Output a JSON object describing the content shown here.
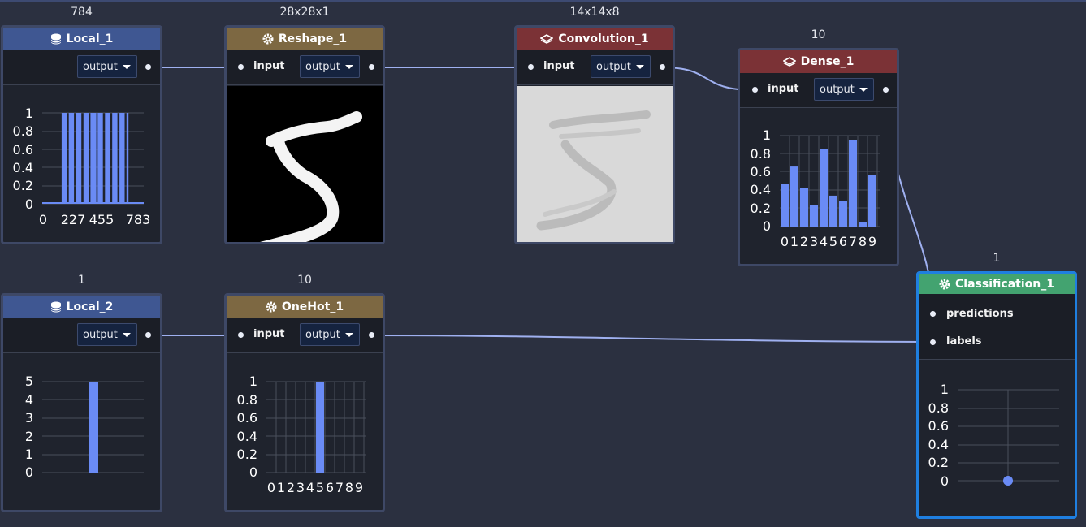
{
  "nodes": {
    "local1": {
      "title": "Local_1",
      "shape": "784",
      "icon": "database-icon",
      "output_label": "output"
    },
    "reshape1": {
      "title": "Reshape_1",
      "shape": "28x28x1",
      "icon": "gear-icon",
      "input_label": "input",
      "output_label": "output"
    },
    "conv1": {
      "title": "Convolution_1",
      "shape": "14x14x8",
      "icon": "layer-icon",
      "input_label": "input",
      "output_label": "output"
    },
    "dense1": {
      "title": "Dense_1",
      "shape": "10",
      "icon": "layer-icon",
      "input_label": "input",
      "output_label": "output"
    },
    "local2": {
      "title": "Local_2",
      "shape": "1",
      "icon": "database-icon",
      "output_label": "output"
    },
    "onehot1": {
      "title": "OneHot_1",
      "shape": "10",
      "icon": "gear-icon",
      "input_label": "input",
      "output_label": "output"
    },
    "class1": {
      "title": "Classification_1",
      "shape": "1",
      "icon": "gear-icon",
      "predictions_label": "predictions",
      "labels_label": "labels"
    }
  },
  "colors": {
    "data_header": "#3f5792",
    "process_header": "#7d6842",
    "layer_header": "#7b3236",
    "classification_header": "#43a370",
    "bars": "#6a8bf5",
    "selected_border": "#1f7fe0"
  },
  "chart_data": [
    {
      "type": "bar",
      "node": "Local_1",
      "xticks": [
        "0",
        "227",
        "455",
        "783"
      ],
      "yticks": [
        "0",
        "0.2",
        "0.4",
        "0.6",
        "0.8",
        "1"
      ],
      "ylim": [
        0,
        1
      ],
      "note_values": "binary values 0/1 across indices 0..783; nonzero pixels mostly between index 150 and 650"
    },
    {
      "type": "bar",
      "node": "Dense_1",
      "categories": [
        "0",
        "1",
        "2",
        "3",
        "4",
        "5",
        "6",
        "7",
        "8",
        "9"
      ],
      "values": [
        0.47,
        0.66,
        0.42,
        0.24,
        0.85,
        0.34,
        0.28,
        0.95,
        0.05,
        0.57
      ],
      "yticks": [
        "0",
        "0.2",
        "0.4",
        "0.6",
        "0.8",
        "1"
      ],
      "ylim": [
        0,
        1
      ]
    },
    {
      "type": "bar",
      "node": "Local_2",
      "categories": [
        "5"
      ],
      "values": [
        5
      ],
      "yticks": [
        "0",
        "1",
        "2",
        "3",
        "4",
        "5"
      ],
      "ylim": [
        0,
        5
      ]
    },
    {
      "type": "bar",
      "node": "OneHot_1",
      "categories": [
        "0",
        "1",
        "2",
        "3",
        "4",
        "5",
        "6",
        "7",
        "8",
        "9"
      ],
      "values": [
        0,
        0,
        0,
        0,
        0,
        1,
        0,
        0,
        0,
        0
      ],
      "yticks": [
        "0",
        "0.2",
        "0.4",
        "0.6",
        "0.8",
        "1"
      ],
      "ylim": [
        0,
        1
      ]
    },
    {
      "type": "scatter",
      "node": "Classification_1",
      "values": [
        0
      ],
      "yticks": [
        "0",
        "0.2",
        "0.4",
        "0.6",
        "0.8",
        "1"
      ],
      "ylim": [
        0,
        1
      ]
    }
  ]
}
